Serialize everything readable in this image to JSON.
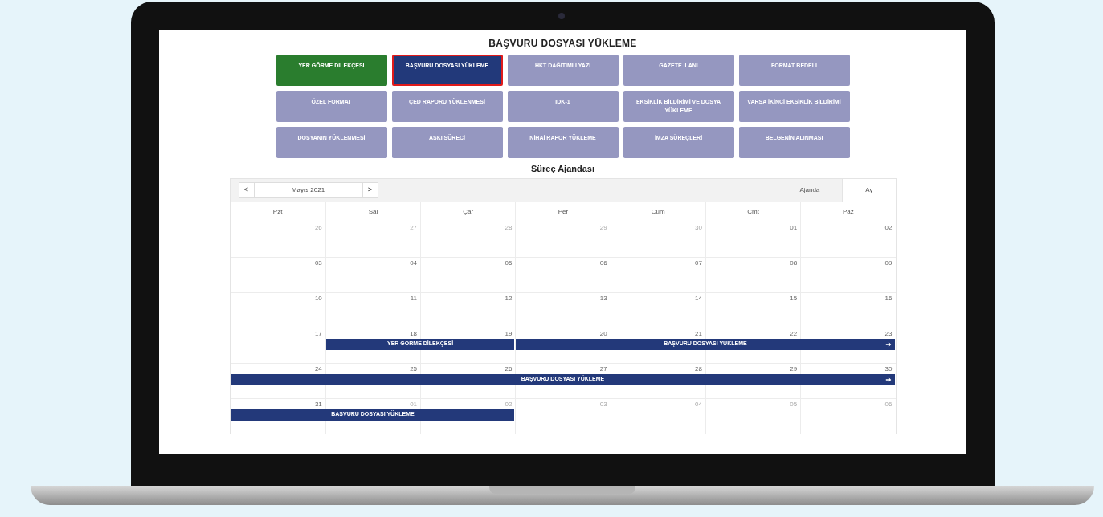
{
  "page_title": "BAŞVURU DOSYASI YÜKLEME",
  "steps": [
    {
      "label": "YER GÖRME DİLEKÇESİ",
      "completed": true,
      "selected": false
    },
    {
      "label": "BAŞVURU DOSYASI YÜKLEME",
      "completed": false,
      "selected": true
    },
    {
      "label": "HKT DAĞITIMLI YAZI",
      "completed": false,
      "selected": false
    },
    {
      "label": "GAZETE İLANI",
      "completed": false,
      "selected": false
    },
    {
      "label": "FORMAT BEDELİ",
      "completed": false,
      "selected": false
    },
    {
      "label": "ÖZEL FORMAT",
      "completed": false,
      "selected": false
    },
    {
      "label": "ÇED RAPORU YÜKLENMESİ",
      "completed": false,
      "selected": false
    },
    {
      "label": "IDK-1",
      "completed": false,
      "selected": false
    },
    {
      "label": "EKSİKLİK BİLDİRİMİ VE DOSYA YÜKLEME",
      "completed": false,
      "selected": false
    },
    {
      "label": "VARSA İKİNCİ EKSİKLİK BİLDİRİMİ",
      "completed": false,
      "selected": false
    },
    {
      "label": "DOSYANIN YÜKLENMESİ",
      "completed": false,
      "selected": false
    },
    {
      "label": "ASKI SÜRECİ",
      "completed": false,
      "selected": false
    },
    {
      "label": "NİHAİ RAPOR YÜKLEME",
      "completed": false,
      "selected": false
    },
    {
      "label": "İMZA SÜREÇLERİ",
      "completed": false,
      "selected": false
    },
    {
      "label": "BELGENİN ALINMASI",
      "completed": false,
      "selected": false
    }
  ],
  "calendar": {
    "title": "Süreç Ajandası",
    "prev": "<",
    "month": "Mayıs 2021",
    "next": ">",
    "views": [
      {
        "label": "Ajanda",
        "selected": false
      },
      {
        "label": "Ay",
        "selected": true
      }
    ],
    "weekdays": [
      "Pzt",
      "Sal",
      "Çar",
      "Per",
      "Cum",
      "Cmt",
      "Paz"
    ],
    "weeks": [
      {
        "days": [
          {
            "label": "26",
            "in_month": false
          },
          {
            "label": "27",
            "in_month": false
          },
          {
            "label": "28",
            "in_month": false
          },
          {
            "label": "29",
            "in_month": false
          },
          {
            "label": "30",
            "in_month": false
          },
          {
            "label": "01",
            "in_month": true
          },
          {
            "label": "02",
            "in_month": true
          }
        ]
      },
      {
        "days": [
          {
            "label": "03",
            "in_month": true
          },
          {
            "label": "04",
            "in_month": true
          },
          {
            "label": "05",
            "in_month": true
          },
          {
            "label": "06",
            "in_month": true
          },
          {
            "label": "07",
            "in_month": true
          },
          {
            "label": "08",
            "in_month": true
          },
          {
            "label": "09",
            "in_month": true
          }
        ]
      },
      {
        "days": [
          {
            "label": "10",
            "in_month": true
          },
          {
            "label": "11",
            "in_month": true
          },
          {
            "label": "12",
            "in_month": true
          },
          {
            "label": "13",
            "in_month": true
          },
          {
            "label": "14",
            "in_month": true
          },
          {
            "label": "15",
            "in_month": true
          },
          {
            "label": "16",
            "in_month": true
          }
        ]
      },
      {
        "days": [
          {
            "label": "17",
            "in_month": true
          },
          {
            "label": "18",
            "in_month": true,
            "event": {
              "label": "YER GÖRME DİLEKÇESİ",
              "continues": false
            }
          },
          {
            "label": "19",
            "in_month": true,
            "event_end": true
          },
          {
            "label": "20",
            "in_month": true,
            "event": {
              "label": "BAŞVURU DOSYASI YÜKLEME",
              "continues": true
            }
          },
          {
            "label": "21",
            "in_month": true
          },
          {
            "label": "22",
            "in_month": true
          },
          {
            "label": "23",
            "in_month": true
          }
        ]
      },
      {
        "days": [
          {
            "label": "24",
            "in_month": true,
            "event": {
              "label": "BAŞVURU DOSYASI YÜKLEME",
              "continues": true
            }
          },
          {
            "label": "25",
            "in_month": true
          },
          {
            "label": "26",
            "in_month": true
          },
          {
            "label": "27",
            "in_month": true
          },
          {
            "label": "28",
            "in_month": true
          },
          {
            "label": "29",
            "in_month": true
          },
          {
            "label": "30",
            "in_month": true
          }
        ]
      },
      {
        "days": [
          {
            "label": "31",
            "in_month": true,
            "event": {
              "label": "BAŞVURU DOSYASI YÜKLEME",
              "continues": false
            }
          },
          {
            "label": "01",
            "in_month": false
          },
          {
            "label": "02",
            "in_month": false,
            "event_end": true
          },
          {
            "label": "03",
            "in_month": false
          },
          {
            "label": "04",
            "in_month": false
          },
          {
            "label": "05",
            "in_month": false
          },
          {
            "label": "06",
            "in_month": false
          }
        ]
      }
    ]
  }
}
